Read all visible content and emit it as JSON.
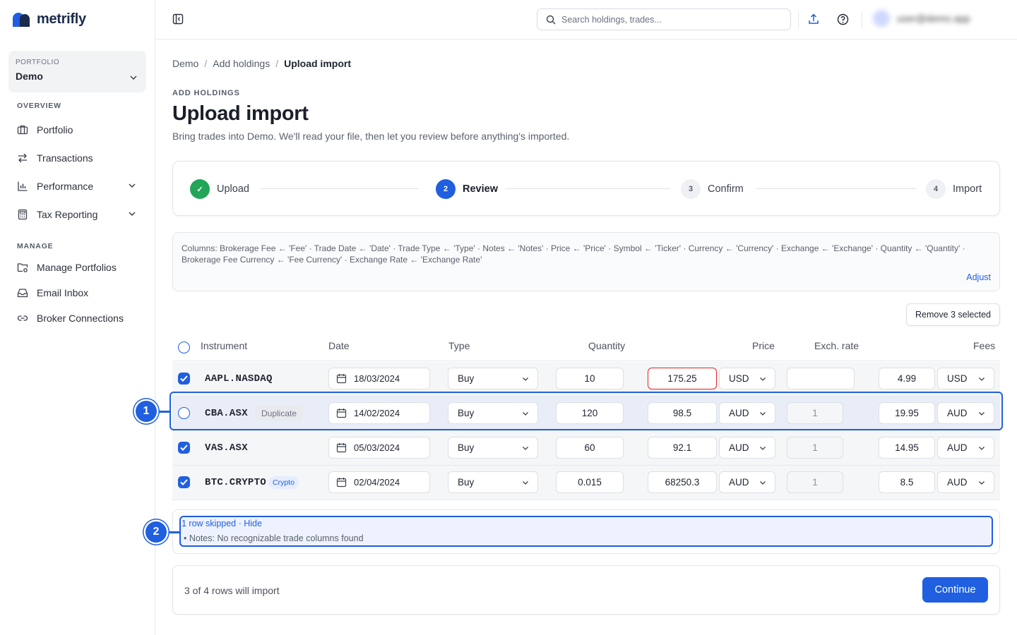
{
  "app": {
    "name": "metrifly"
  },
  "sidebar": {
    "portfolio_label": "PORTFOLIO",
    "portfolio_value": "Demo",
    "overview_label": "OVERVIEW",
    "manage_label": "MANAGE",
    "overview_items": [
      {
        "label": "Portfolio",
        "icon": "briefcase-icon"
      },
      {
        "label": "Transactions",
        "icon": "arrows-swap-icon"
      },
      {
        "label": "Performance",
        "icon": "bar-chart-icon",
        "expandable": true
      },
      {
        "label": "Tax Reporting",
        "icon": "calculator-icon",
        "expandable": true
      }
    ],
    "manage_items": [
      {
        "label": "Manage Portfolios",
        "icon": "folder-settings-icon"
      },
      {
        "label": "Email Inbox",
        "icon": "inbox-icon"
      },
      {
        "label": "Broker Connections",
        "icon": "link-icon"
      }
    ]
  },
  "topbar": {
    "search_placeholder": "Search holdings, trades...",
    "user_name": "user@demo.app"
  },
  "breadcrumb": {
    "items": [
      "Demo",
      "Add holdings"
    ],
    "current": "Upload import"
  },
  "header": {
    "eyebrow": "ADD HOLDINGS",
    "title": "Upload import",
    "subtitle": "Bring trades into Demo. We'll read your file, then let you review before anything's imported."
  },
  "stepper": {
    "steps": [
      {
        "label": "Upload",
        "num": "✓",
        "state": "done"
      },
      {
        "label": "Review",
        "num": "2",
        "state": "active"
      },
      {
        "label": "Confirm",
        "num": "3",
        "state": "todo"
      },
      {
        "label": "Import",
        "num": "4",
        "state": "todo"
      }
    ]
  },
  "mapping": {
    "text": "Columns: Brokerage Fee ← 'Fee' · Trade Date ← 'Date' · Trade Type ← 'Type' · Notes ← 'Notes' · Price ← 'Price' · Symbol ← 'Ticker' · Currency ← 'Currency' · Exchange ← 'Exchange' · Quantity ← 'Quantity' · Brokerage Fee Currency ← 'Fee Currency' · Exchange Rate ← 'Exchange Rate'",
    "adjust_label": "Adjust"
  },
  "table": {
    "remove_label": "Remove 3 selected",
    "headers": {
      "instrument": "Instrument",
      "date": "Date",
      "type": "Type",
      "quantity": "Quantity",
      "price": "Price",
      "exch_rate": "Exch. rate",
      "fees": "Fees"
    },
    "rows": [
      {
        "symbol": "AAPL.NASDAQ",
        "badge": "",
        "checked": true,
        "date": "18/03/2024",
        "type": "Buy",
        "quantity": "10",
        "price": "175.25",
        "price_error": true,
        "currency": "USD",
        "exch_rate": "",
        "fee": "4.99",
        "fee_currency": "USD"
      },
      {
        "symbol": "CBA.ASX",
        "badge": "Duplicate",
        "checked": false,
        "date": "14/02/2024",
        "type": "Buy",
        "quantity": "120",
        "price": "98.5",
        "price_error": false,
        "currency": "AUD",
        "exch_rate": "1",
        "fee": "19.95",
        "fee_currency": "AUD"
      },
      {
        "symbol": "VAS.ASX",
        "badge": "",
        "checked": true,
        "date": "05/03/2024",
        "type": "Buy",
        "quantity": "60",
        "price": "92.1",
        "price_error": false,
        "currency": "AUD",
        "exch_rate": "1",
        "fee": "14.95",
        "fee_currency": "AUD"
      },
      {
        "symbol": "BTC.CRYPTO",
        "badge": "Crypto",
        "checked": true,
        "date": "02/04/2024",
        "type": "Buy",
        "quantity": "0.015",
        "price": "68250.3",
        "price_error": false,
        "currency": "AUD",
        "exch_rate": "1",
        "fee": "8.5",
        "fee_currency": "AUD"
      }
    ]
  },
  "skipped": {
    "link": "1 row skipped · Hide",
    "note": "•  Notes: No recognizable trade columns found"
  },
  "footer": {
    "count": "3 of 4 rows will import",
    "continue_label": "Continue"
  },
  "annotations": {
    "marker1": "1",
    "marker2": "2"
  },
  "colors": {
    "accent": "#1f5fe0",
    "success": "#22a559",
    "error": "#e02424"
  }
}
